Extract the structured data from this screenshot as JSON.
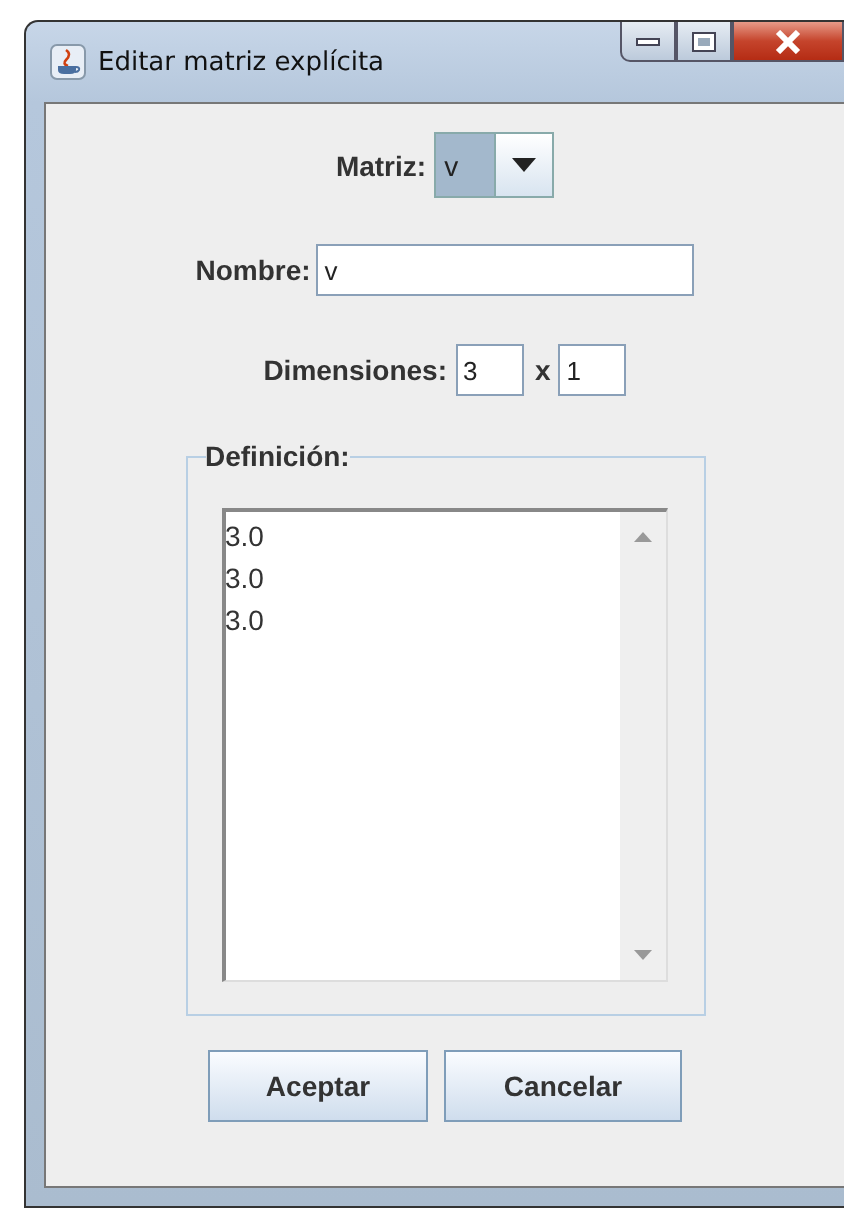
{
  "window": {
    "title": "Editar matriz explícita"
  },
  "matrix": {
    "label": "Matriz:",
    "value": "v"
  },
  "name": {
    "label": "Nombre:",
    "value": "v"
  },
  "dimensions": {
    "label": "Dimensiones:",
    "rows": "3",
    "separator": "x",
    "cols": "1"
  },
  "definition": {
    "legend": "Definición:",
    "lines": [
      "3.0",
      "3.0",
      "3.0"
    ]
  },
  "buttons": [
    "Aceptar",
    "Cancelar"
  ]
}
